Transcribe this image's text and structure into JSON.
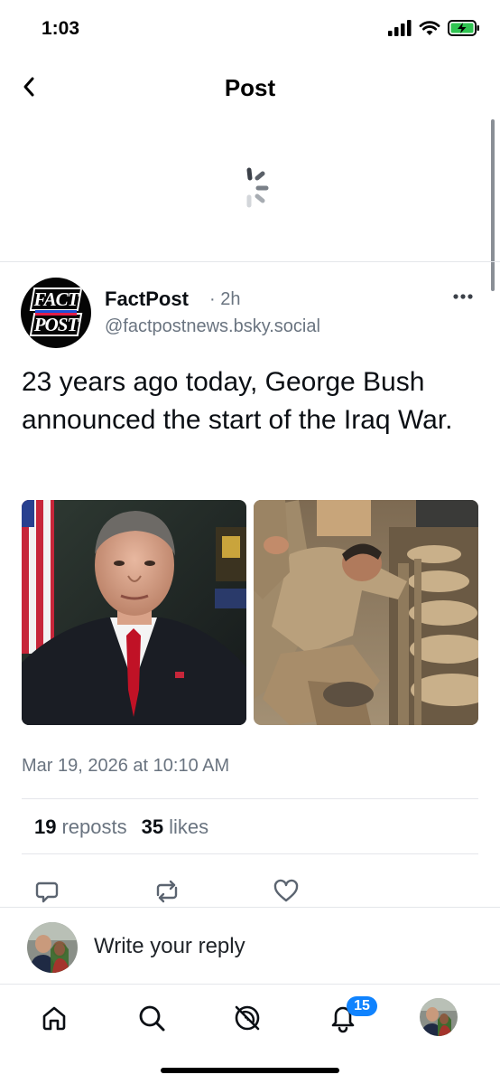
{
  "status_bar": {
    "time": "1:03"
  },
  "header": {
    "title": "Post"
  },
  "post": {
    "author_name": "FactPost",
    "time_ago": "· 2h",
    "handle": "@factpostnews.bsky.social",
    "avatar_text_top": "FACT",
    "avatar_text_bottom": "POST",
    "text": "23 years ago today, George Bush announced the start of the Iraq War.",
    "date": "Mar 19, 2026 at 10:10 AM",
    "reposts_count": "19",
    "reposts_label": "reposts",
    "likes_count": "35",
    "likes_label": "likes"
  },
  "reply": {
    "placeholder": "Write your reply"
  },
  "tab_bar": {
    "notifications_badge": "15"
  },
  "colors": {
    "accent": "#1083fe",
    "muted_text": "#6a7480",
    "divider": "#e4e6ea",
    "battery_green": "#30c452"
  }
}
